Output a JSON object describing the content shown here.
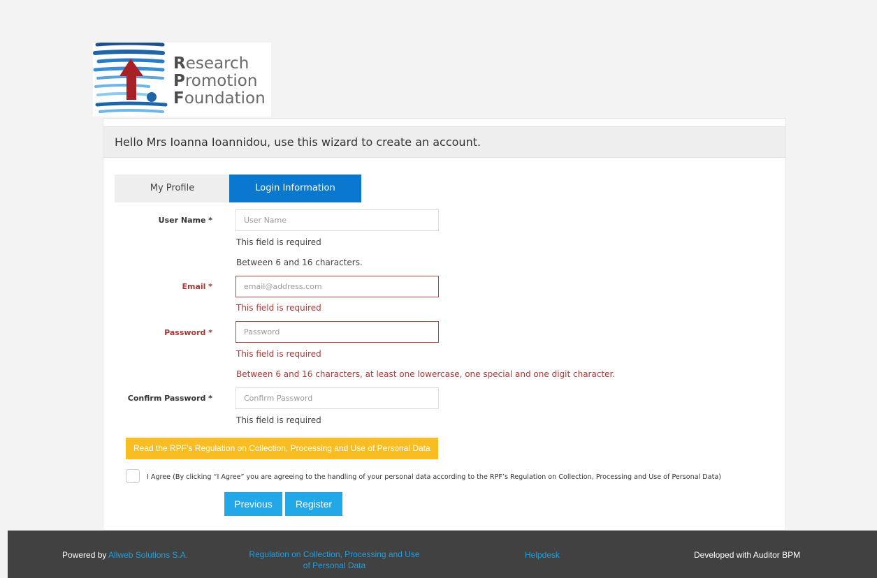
{
  "logo": {
    "alt": "Research Promotion Foundation logo",
    "line1_initial": "R",
    "line1_rest": "esearch",
    "line2_initial": "P",
    "line2_rest": "romotion",
    "line3_initial": "F",
    "line3_rest": "oundation",
    "colors": {
      "stripes": "#1f65a8",
      "arrow": "#a62025",
      "dot": "#1f65a8"
    }
  },
  "header": {
    "text": "Hello Mrs Ioanna Ioannidou, use this wizard to create an account."
  },
  "tabs": [
    {
      "label": "My Profile",
      "active": false
    },
    {
      "label": "Login Information",
      "active": true
    }
  ],
  "form": {
    "username": {
      "label": "User Name *",
      "placeholder": "User Name",
      "value": "",
      "error": "This field is required",
      "hint": "Between 6 and 16 characters."
    },
    "email": {
      "label": "Email *",
      "placeholder": "email@address.com",
      "value": "",
      "error": "This field is required"
    },
    "password": {
      "label": "Password *",
      "placeholder": "Password",
      "value": "",
      "error": "This field is required",
      "hint": "Between 6 and 16 characters, at least one lowercase, one special and one digit character."
    },
    "confirm_password": {
      "label": "Confirm Password *",
      "placeholder": "Confirm Password",
      "value": "",
      "error": "This field is required"
    }
  },
  "regulation_button": "Read the RPF’s Regulation on Collection, Processing and Use of Personal Data",
  "agree": {
    "checked": false,
    "text": "I Agree (By clicking “I Agree” you are agreeing to the handling of your personal data according to the RPF’s Regulation on Collection, Processing and Use of Personal Data)"
  },
  "buttons": {
    "previous": "Previous",
    "register": "Register"
  },
  "footer": {
    "powered_prefix": "Powered by ",
    "powered_link": "Allweb Solutions S.A.",
    "regulation_line1": "Regulation on Collection, Processing and Use",
    "regulation_line2": "of Personal Data",
    "helpdesk": "Helpdesk",
    "developed": "Developed with Auditor BPM"
  },
  "colors": {
    "accent_tab": "#0a78cf",
    "button": "#22a7e8",
    "warning_button": "#f7bd23",
    "error": "#a83838",
    "footer_bg": "#414141",
    "footer_link": "#1e9fe0"
  }
}
